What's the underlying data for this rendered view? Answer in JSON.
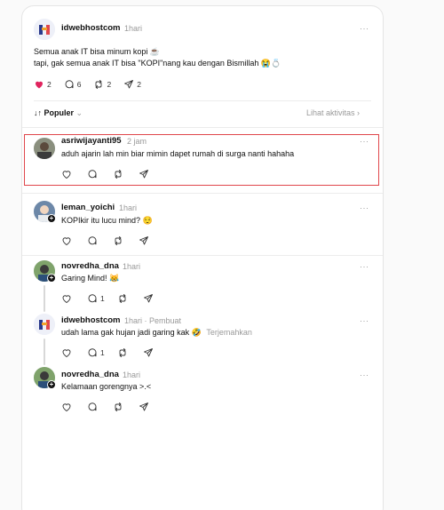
{
  "post": {
    "author": "idwebhostcom",
    "time": "1hari",
    "more": "···",
    "line1": "Semua anak IT bisa minum kopi ☕",
    "line2": "tapi, gak semua anak IT bisa \"KOPI\"nang kau dengan Bismillah 😭💍",
    "likes": "2",
    "comments": "6",
    "reposts": "2",
    "shares": "2"
  },
  "sort": {
    "label": "↓↑ Populer",
    "chevron": "⌄",
    "activity": "Lihat aktivitas",
    "activity_chevron": "›"
  },
  "replies": [
    {
      "author": "asriwijayanti95",
      "time": "2 jam",
      "more": "···",
      "text": "aduh ajarin lah min biar mimin dapet rumah di surga nanti hahaha",
      "comments": ""
    },
    {
      "author": "leman_yoichi",
      "time": "1hari",
      "more": "···",
      "text": "KOPIkir itu lucu mind? 😌",
      "comments": ""
    },
    {
      "author": "novredha_dna",
      "time": "1hari",
      "more": "···",
      "text": "Garing Mind! 😹",
      "comments": "1"
    },
    {
      "author": "idwebhostcom",
      "time": "1hari",
      "creator": "· Pembuat",
      "more": "···",
      "text": "udah lama gak hujan jadi garing kak 🤣",
      "translate": "Terjemahkan",
      "comments": "1"
    },
    {
      "author": "novredha_dna",
      "time": "1hari",
      "more": "···",
      "text": "Kelamaan gorengnya >.<",
      "comments": ""
    }
  ],
  "icons": {
    "like": "heart-icon",
    "comment": "comment-icon",
    "repost": "repost-icon",
    "share": "share-icon",
    "more": "more-icon"
  },
  "colors": {
    "like_active": "#e0245e",
    "highlight": "#e0474c",
    "muted": "#999999"
  }
}
